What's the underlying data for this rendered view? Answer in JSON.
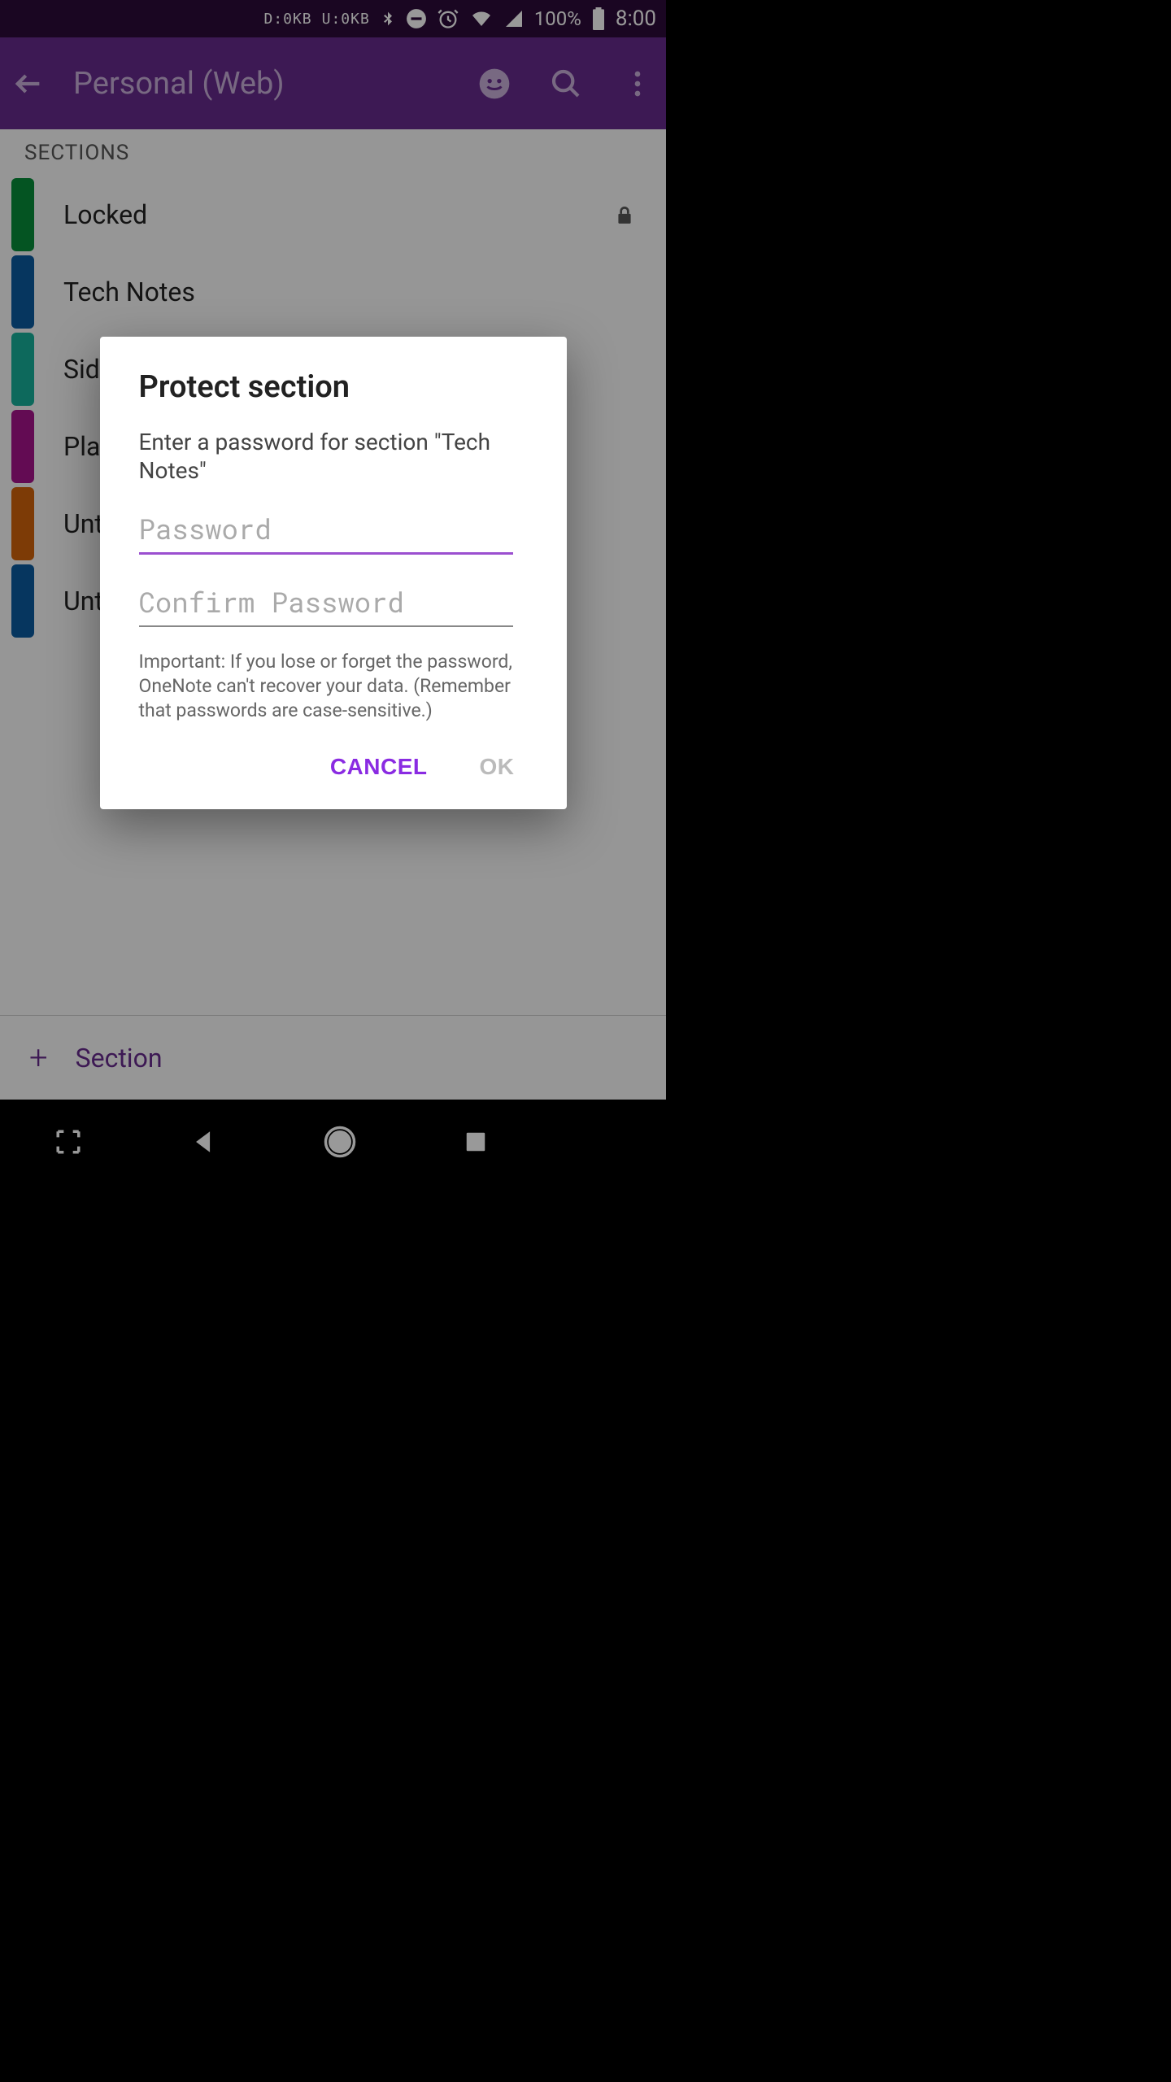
{
  "status": {
    "down": "D:0KB",
    "up": "U:0KB",
    "battery_pct": "100%",
    "clock": "8:00"
  },
  "appbar": {
    "title": "Personal (Web)"
  },
  "sections_header": "SECTIONS",
  "sections": [
    {
      "title": "Locked",
      "color": "#078d3a",
      "locked": true
    },
    {
      "title": "Tech Notes",
      "color": "#0a5a9e",
      "locked": false
    },
    {
      "title": "Side",
      "color": "#17b09a",
      "locked": false
    },
    {
      "title": "Plans",
      "color": "#a6138a",
      "locked": false
    },
    {
      "title": "Untitled",
      "color": "#d0630a",
      "locked": false
    },
    {
      "title": "Untitled",
      "color": "#0a5a9e",
      "locked": false
    }
  ],
  "add_section_label": "Section",
  "dialog": {
    "title": "Protect section",
    "message": "Enter a password for section \"Tech Notes\"",
    "password_placeholder": "Password",
    "confirm_placeholder": "Confirm Password",
    "note": "Important: If you lose or forget the password, OneNote can't recover your data. (Remember that passwords are case-sensitive.)",
    "cancel": "CANCEL",
    "ok": "OK"
  }
}
